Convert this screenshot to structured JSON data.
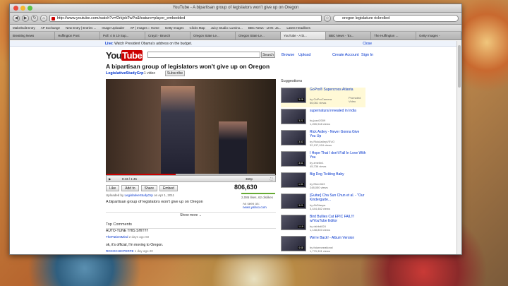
{
  "window": {
    "title": "YouTube - A bipartisan group of legislators won't give up on Oregon"
  },
  "nav": {
    "url": "http://www.youtube.com/watch?v=f2rkjxbTwPo&feature=player_embedded",
    "search": "oregon legislature rickrolled"
  },
  "bookmarks": [
    "Make/Edit Entry",
    "AP Exchange",
    "New Entry | Entries ...",
    "Image Uploader",
    "AP | Images :: Home",
    "Getty Images",
    "Clicks Map",
    "Juicy Studio: Lumino...",
    "BBC News - LIVE: Ja...",
    "Latest Headlines"
  ],
  "tabs": [
    "Breaking News",
    "Huffington Post",
    "Poll: 4 in 10 Sup...",
    "Crayzt - Brunch",
    "Oregon State Le...",
    "Oregon State Le...",
    "YouTube - A bi...",
    "BBC News - 'Ex...",
    "The Huffington ...",
    "Getty Images -"
  ],
  "alert": {
    "label": "Live:",
    "text": "Watch President Obama's address on the budget.",
    "close": "Close"
  },
  "yt": {
    "logo_you": "You",
    "logo_tube": "Tube",
    "search_btn": "Search",
    "browse": "Browse",
    "upload": "Upload",
    "create": "Create Account",
    "signin": "Sign In"
  },
  "video": {
    "title": "A bipartisan group of legislators won't give up on Oregon",
    "channel": "LegislativeStudyGrp",
    "count": "1 video",
    "subscribe": "Subscribe",
    "time": "0:43 / 1:45",
    "quality": "360p",
    "views": "806,630",
    "uploaded_prefix": "Uploaded by",
    "uploader": "LegislativeStudyGrp",
    "uploaded_date": "on Apr 1, 2011",
    "description": "A bipartisan group of legislators won't give up on Oregon",
    "likes": "2,086 likes, 62 dislikes",
    "seen_label": "As seen on:",
    "seen_site": "news.yahoo.com",
    "show_more": "Show more",
    "progress": 0.41
  },
  "actions": [
    "Like",
    "Add to",
    "Share",
    "Embed"
  ],
  "comments": {
    "header": "Top Comments",
    "items": [
      {
        "text": "AUTO-TUNE THIS SHIT!!!!",
        "user": "ThePatientMind",
        "meta": "2 days ago 60"
      },
      {
        "text": "ok, it's official, I'm moving to Oregon.",
        "user": "ROCOCHICPERFE",
        "meta": "1 day ago 20"
      }
    ]
  },
  "suggestions": {
    "header": "Suggestions",
    "items": [
      {
        "title": "GoPro® Supercross Atlanta",
        "by": "by GoProCamera",
        "views": "66,061 views",
        "dur": "3:28",
        "promo": "Promoted Video"
      },
      {
        "title": "supernatural revealed in India",
        "by": "by jazzi2009",
        "views": "1,265,948 views",
        "dur": "3:21"
      },
      {
        "title": "Rick Astley - Never Gonna Give You Up",
        "by": "by RickAstleyVEVO",
        "views": "32,137,024 views",
        "dur": "3:33"
      },
      {
        "title": "I Hope That I don't Fall In Love With You",
        "by": "by zmeibr1",
        "views": "45,736 views",
        "dur": "3:41"
      },
      {
        "title": "Big Dog Tickling Baby",
        "by": "by Eben343",
        "views": "248,050 views",
        "dur": "1:31"
      },
      {
        "title": "[Guitar] Cha Sun Chun et al. - \"Our Kindergarte...",
        "by": "by AhDiasya",
        "views": "3,444,482 views",
        "dur": "3:21"
      },
      {
        "title": "Bird Bullies Cat EPIC FAIL!!! w/YouTube Editor",
        "by": "by dshbd824",
        "views": "1,148,803 views",
        "dur": "1:19"
      },
      {
        "title": "We're Back! - Album Version",
        "by": "by futurecreations!",
        "views": "1,779,391 views",
        "dur": "4:48"
      }
    ]
  }
}
